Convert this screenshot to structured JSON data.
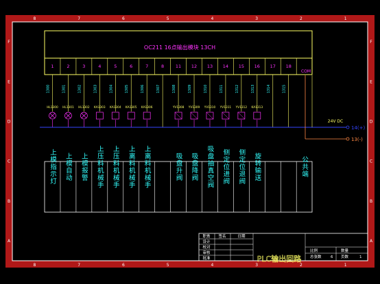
{
  "module": {
    "title": "OC211 16点输出模块 13CH",
    "terminals": [
      "1",
      "2",
      "3",
      "4",
      "5",
      "6",
      "7",
      "8",
      "11",
      "12",
      "13",
      "14",
      "15",
      "16",
      "17",
      "18"
    ],
    "com_label": "COM"
  },
  "addresses": [
    "1300",
    "1301",
    "1302",
    "1303",
    "1304",
    "1305",
    "1306",
    "1307",
    "1308",
    "1309",
    "1310",
    "1311",
    "1312",
    "1313",
    "1314",
    "1315"
  ],
  "loads": [
    {
      "tag": "HL1300",
      "type": "lamp"
    },
    {
      "tag": "HL1301",
      "type": "lamp"
    },
    {
      "tag": "HL1302",
      "type": "lamp"
    },
    {
      "tag": "KA1303",
      "type": "relay"
    },
    {
      "tag": "KA1304",
      "type": "relay"
    },
    {
      "tag": "KA1305",
      "type": "relay"
    },
    {
      "tag": "KA1306",
      "type": "relay"
    },
    {
      "tag": "",
      "type": "none"
    },
    {
      "tag": "YV1308",
      "type": "valve"
    },
    {
      "tag": "YV1309",
      "type": "valve"
    },
    {
      "tag": "YV1310",
      "type": "valve"
    },
    {
      "tag": "YV1311",
      "type": "valve"
    },
    {
      "tag": "YV1312",
      "type": "valve"
    },
    {
      "tag": "KA1313",
      "type": "relay"
    },
    {
      "tag": "",
      "type": "none"
    },
    {
      "tag": "",
      "type": "none"
    }
  ],
  "power": {
    "label": "24V DC",
    "positive": "14(+)",
    "negative": "13(-)"
  },
  "functions": [
    "上模指示灯",
    "上模自动",
    "上模报警",
    "上压料机械手",
    "上压料机械手",
    "上离料机械手",
    "上离料机械手",
    "",
    "吸盘升阀",
    "吸盘降阀",
    "吸盘抽真空阀",
    "侧定位进阀",
    "侧定位退阀",
    "旋转输送",
    "",
    "",
    "公共端"
  ],
  "title_block": {
    "header": [
      "职责",
      "签名",
      "日期"
    ],
    "roles": [
      "设计",
      "校对",
      "审核",
      "批准"
    ],
    "drawing_title": "PLC输出回路",
    "field_ratio": "比例",
    "field_qty": "数量",
    "field_total": "总张数",
    "total_value": "6",
    "field_sheet": "页数",
    "sheet_value": "1"
  },
  "border_columns": [
    "8",
    "7",
    "6",
    "5",
    "4",
    "3",
    "2",
    "1"
  ],
  "border_rows": [
    "F",
    "E",
    "D",
    "C",
    "B",
    "A"
  ],
  "colors": {
    "frame": "#ffffff",
    "module": "#ffff66",
    "text_magenta": "#ff33ff",
    "cyan": "#33ffff",
    "bus_blue": "#3344ff",
    "neg_orange": "#ff8844",
    "ruler": "#dd2222",
    "loads": "#ff33ff"
  }
}
